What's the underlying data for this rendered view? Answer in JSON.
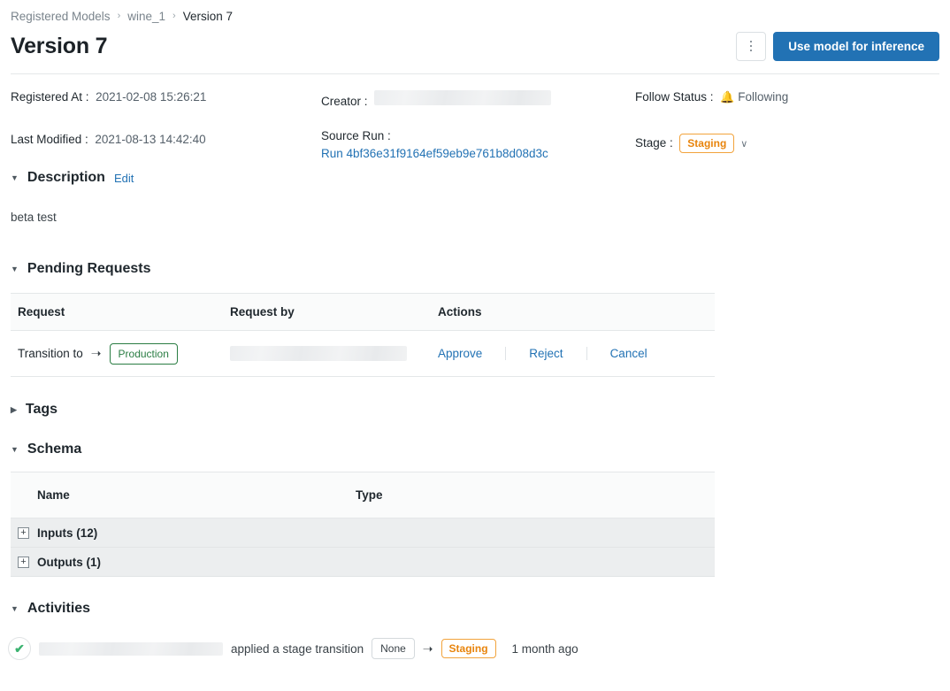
{
  "breadcrumb": {
    "items": [
      {
        "label": "Registered Models",
        "current": false
      },
      {
        "label": "wine_1",
        "current": false
      },
      {
        "label": "Version 7",
        "current": true
      }
    ],
    "separator": "›"
  },
  "header": {
    "title": "Version 7",
    "kebab_label": "More options",
    "primary_button": "Use model for inference"
  },
  "meta": {
    "registered_at_label": "Registered At",
    "registered_at_value": "2021-02-08 15:26:21",
    "last_modified_label": "Last Modified",
    "last_modified_value": "2021-08-13 14:42:40",
    "creator_label": "Creator",
    "creator_value": "",
    "source_run_label": "Source Run",
    "source_run_link": "Run 4bf36e31f9164ef59eb9e761b8d08d3c",
    "follow_status_label": "Follow Status",
    "follow_status_value": "Following",
    "follow_icon": "bell-icon",
    "stage_label": "Stage",
    "stage_value": "Staging",
    "stage_chevron": "∨"
  },
  "description": {
    "heading": "Description",
    "edit_label": "Edit",
    "body": "beta test",
    "expanded": true,
    "caret": "▼"
  },
  "pending_requests": {
    "heading": "Pending Requests",
    "caret": "▼",
    "columns": [
      "Request",
      "Request by",
      "Actions"
    ],
    "rows": [
      {
        "request_prefix": "Transition to",
        "arrow": "➝",
        "target_stage": "Production",
        "request_by": "",
        "actions": [
          "Approve",
          "Reject",
          "Cancel"
        ]
      }
    ]
  },
  "tags": {
    "heading": "Tags",
    "caret": "▶",
    "expanded": false
  },
  "schema": {
    "heading": "Schema",
    "caret": "▼",
    "columns": [
      "Name",
      "Type"
    ],
    "rows": [
      {
        "name": "Inputs (12)",
        "type": "",
        "expander": "+"
      },
      {
        "name": "Outputs (1)",
        "type": "",
        "expander": "+"
      }
    ]
  },
  "activities": {
    "heading": "Activities",
    "caret": "▼",
    "rows": [
      {
        "status_icon": "check-circle-icon",
        "actor": "",
        "text": "applied a stage transition",
        "from_stage": "None",
        "arrow": "➝",
        "to_stage": "Staging",
        "time": "1 month ago"
      }
    ]
  },
  "colors": {
    "primary_blue": "#2272b4",
    "link_blue": "#2272b4",
    "staging_orange": "#e8840c",
    "production_green": "#2a7d43",
    "check_green": "#3cb371",
    "border_gray": "#e4e7e9"
  }
}
